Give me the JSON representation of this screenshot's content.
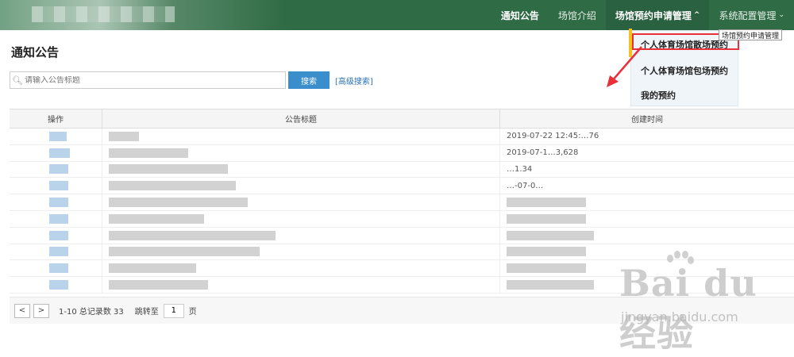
{
  "nav": {
    "items": [
      {
        "label": "通知公告"
      },
      {
        "label": "场馆介绍"
      },
      {
        "label": "场馆预约申请管理"
      },
      {
        "label": "系统配置管理"
      }
    ]
  },
  "page": {
    "title": "通知公告"
  },
  "search": {
    "placeholder": "请输入公告标题",
    "button_label": "搜索",
    "advanced_label": "[高级搜索]"
  },
  "table": {
    "headers": [
      "操作",
      "公告标题",
      "创建时间"
    ],
    "rows": [
      {
        "date": "2019-07-22 12:45:…76"
      },
      {
        "date": "2019-07-1…3,628"
      },
      {
        "date": "…1.34"
      },
      {
        "date": "…-07-0…"
      },
      {
        "date": ""
      },
      {
        "date": ""
      },
      {
        "date": ""
      },
      {
        "date": ""
      },
      {
        "date": ""
      },
      {
        "date": ""
      }
    ]
  },
  "pager": {
    "prev": "<",
    "next": ">",
    "info": "1-10 总记录数 33",
    "jump_label": "跳转至",
    "page_value": "1",
    "page_unit": "页"
  },
  "dropdown": {
    "items": [
      {
        "label": "个人体育场馆散场预约"
      },
      {
        "label": "个人体育场馆包场预约"
      },
      {
        "label": "我的预约"
      }
    ],
    "tooltip": "场馆预约申请管理"
  },
  "watermark": {
    "brand": "Bai du 经验",
    "url": "jingyan.baidu.com"
  },
  "colors": {
    "nav_bg": "#2f6b45",
    "accent_blue": "#3a8ecb",
    "highlight_red": "#e8313a"
  }
}
